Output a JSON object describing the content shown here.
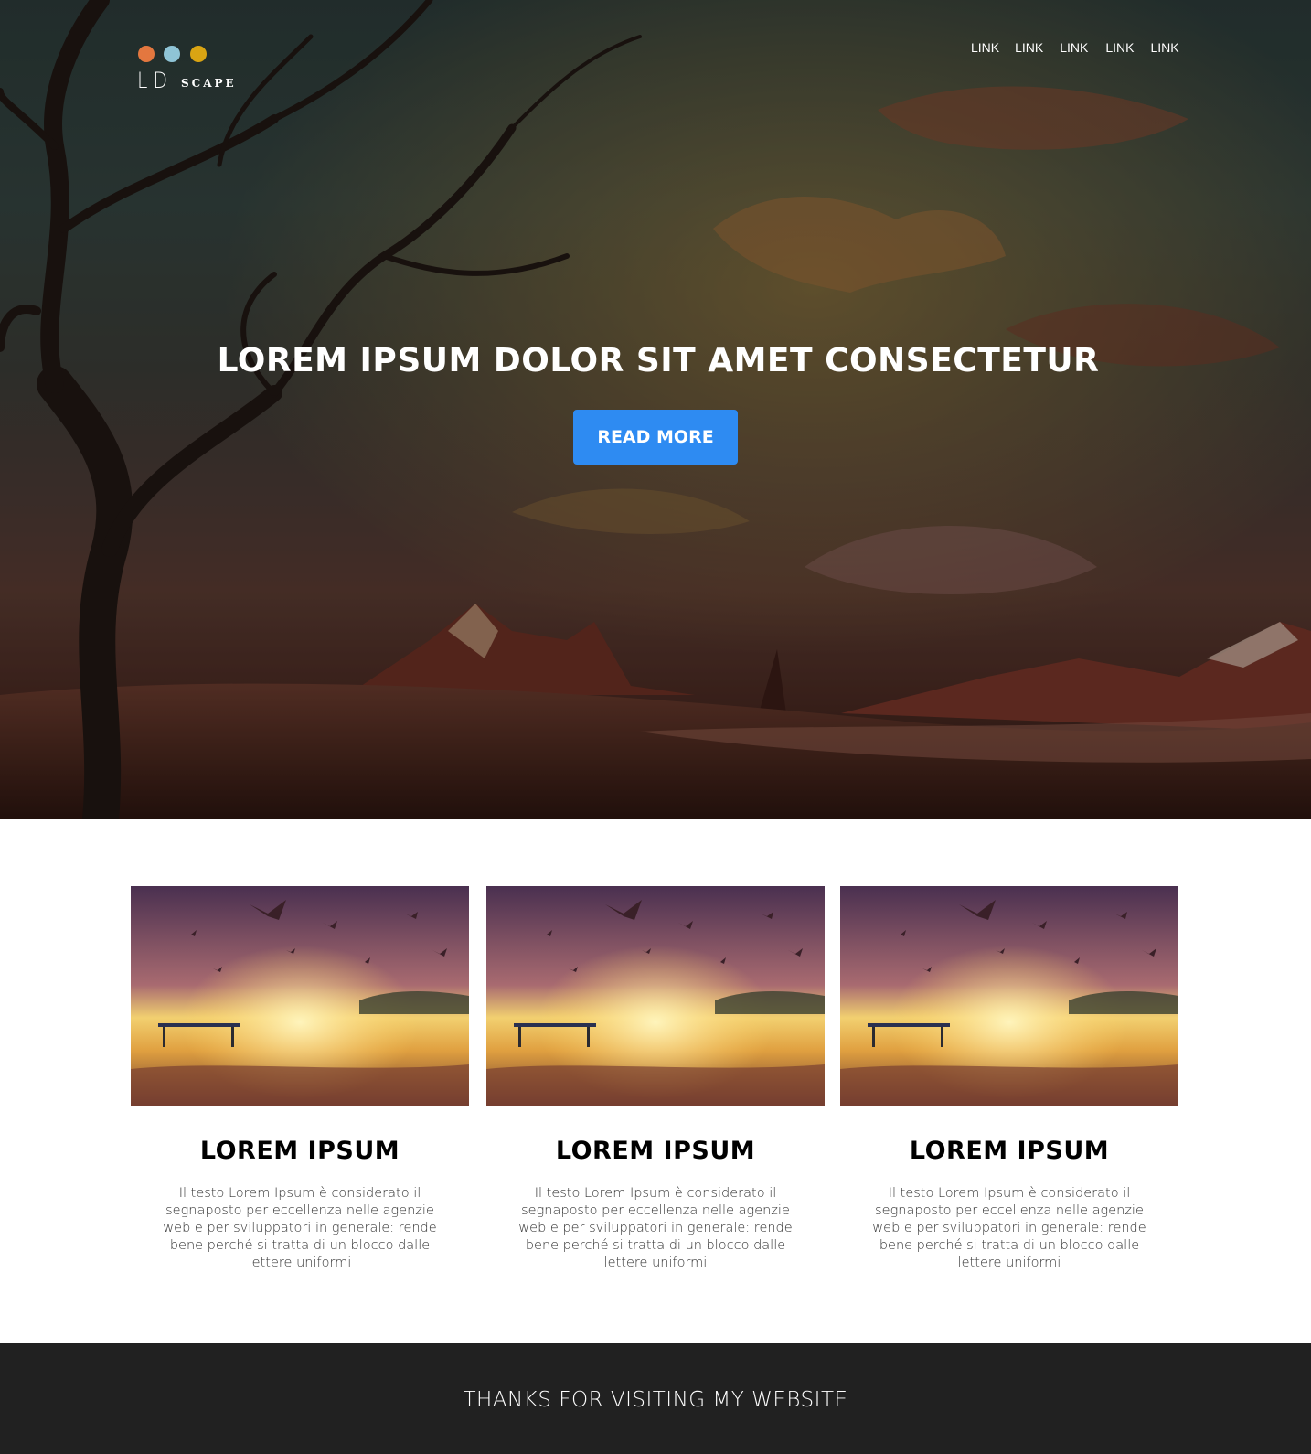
{
  "colors": {
    "dot_orange": "#e3773f",
    "dot_blue": "#8fc4d6",
    "dot_gold": "#d9a413",
    "button_blue": "#2e8bf2",
    "footer_bg": "#212121"
  },
  "logo": {
    "letters": "LD",
    "word": "SCAPE"
  },
  "nav": [
    "LINK",
    "LINK",
    "LINK",
    "LINK",
    "LINK"
  ],
  "hero": {
    "title": "LOREM IPSUM DOLOR SIT AMET CONSECTETUR",
    "button_label": "READ MORE"
  },
  "cards": [
    {
      "title": "LOREM IPSUM",
      "text": "Il testo Lorem Ipsum è considerato il segnaposto per eccellenza nelle agenzie web e per sviluppatori in generale: rende bene perché si tratta di un blocco dalle lettere uniformi"
    },
    {
      "title": "LOREM IPSUM",
      "text": "Il testo Lorem Ipsum è considerato il segnaposto per eccellenza nelle agenzie web e per sviluppatori in generale: rende bene perché si tratta di un blocco dalle lettere uniformi"
    },
    {
      "title": "LOREM IPSUM",
      "text": "Il testo Lorem Ipsum è considerato il segnaposto per eccellenza nelle agenzie web e per sviluppatori in generale: rende bene perché si tratta di un blocco dalle lettere uniformi"
    }
  ],
  "footer": {
    "text": "THANKS FOR VISITING MY WEBSITE"
  }
}
